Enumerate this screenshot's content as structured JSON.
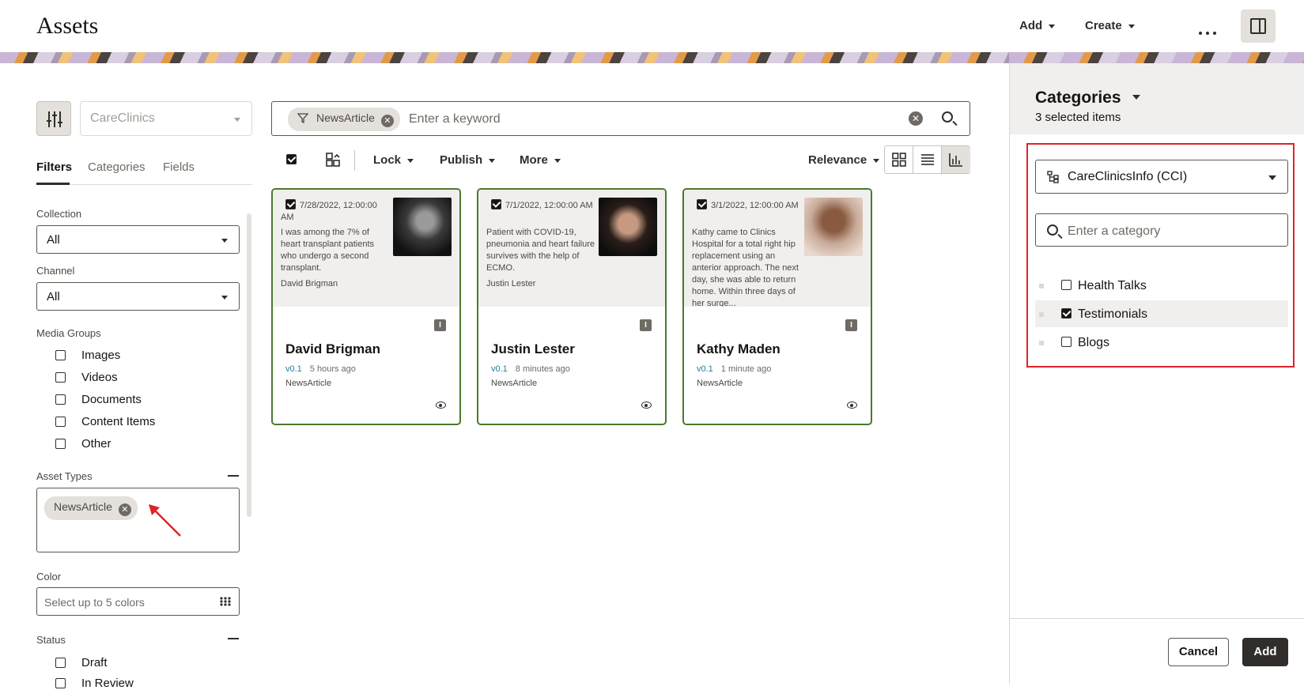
{
  "header": {
    "title": "Assets",
    "add_label": "Add",
    "create_label": "Create"
  },
  "filters": {
    "repository": "CareClinics",
    "tabs": [
      "Filters",
      "Categories",
      "Fields"
    ],
    "collection_label": "Collection",
    "collection_value": "All",
    "channel_label": "Channel",
    "channel_value": "All",
    "media_groups_label": "Media Groups",
    "media_groups": [
      "Images",
      "Videos",
      "Documents",
      "Content Items",
      "Other"
    ],
    "asset_types_label": "Asset Types",
    "asset_type_chip": "NewsArticle",
    "color_label": "Color",
    "color_placeholder": "Select up to 5 colors",
    "status_label": "Status",
    "statuses": [
      "Draft",
      "In Review"
    ]
  },
  "search": {
    "chip": "NewsArticle",
    "placeholder": "Enter a keyword"
  },
  "toolbar": {
    "lock_label": "Lock",
    "publish_label": "Publish",
    "more_label": "More",
    "sort_label": "Relevance"
  },
  "cards": [
    {
      "date": "7/28/2022, 12:00:00 AM",
      "excerpt": "I was among the 7% of heart transplant patients who undergo a second transplant.",
      "author": "David Brigman",
      "title": "David Brigman",
      "version": "v0.1",
      "time": "5 hours ago",
      "type": "NewsArticle",
      "badge": "I"
    },
    {
      "date": "7/1/2022, 12:00:00 AM",
      "excerpt": "Patient with COVID-19, pneumonia and heart failure survives with the help of ECMO.",
      "author": "Justin Lester",
      "title": "Justin Lester",
      "version": "v0.1",
      "time": "8 minutes ago",
      "type": "NewsArticle",
      "badge": "I"
    },
    {
      "date": "3/1/2022, 12:00:00 AM",
      "excerpt": "Kathy came to Clinics Hospital for a total right hip replacement using an anterior approach. The next day, she was able to return home. Within three days of her surge...",
      "author": "",
      "title": "Kathy Maden",
      "version": "v0.1",
      "time": "1 minute ago",
      "type": "NewsArticle",
      "badge": "I"
    }
  ],
  "categories_panel": {
    "title": "Categories",
    "subtitle": "3 selected items",
    "taxonomy": "CareClinicsInfo (CCI)",
    "search_placeholder": "Enter a category",
    "items": [
      {
        "label": "Health Talks",
        "checked": false
      },
      {
        "label": "Testimonials",
        "checked": true
      },
      {
        "label": "Blogs",
        "checked": false
      }
    ],
    "cancel_label": "Cancel",
    "add_label": "Add"
  },
  "colors": {
    "card_border": "#4a7a2c",
    "highlight": "#e0232a",
    "primary_button": "#312d2a"
  }
}
